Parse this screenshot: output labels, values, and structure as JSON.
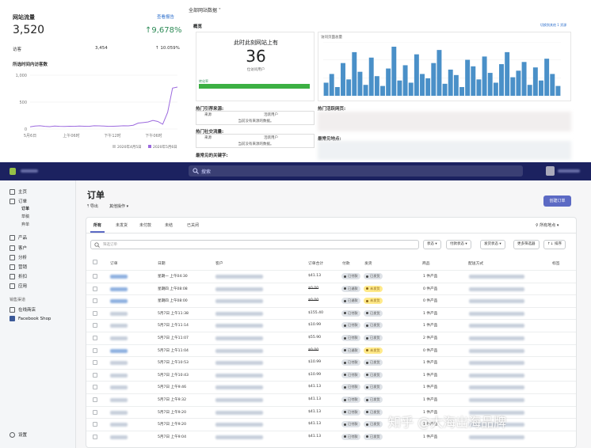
{
  "stats": {
    "title": "网站流量",
    "report_link": "查看报告",
    "total": "3,520",
    "change": "↑9,678%",
    "row_label": "访客",
    "row_value": "3,454",
    "row_change": "↑ 10.059%",
    "chart_title": "所选时间内访客数",
    "legend": [
      "2020年4月5日",
      "2020年5月6日"
    ],
    "colors": {
      "accent": "#2e8b57",
      "line": "#9c6ade",
      "link": "#2c6ecb"
    }
  },
  "chart_data": {
    "type": "line",
    "title": "所选时间内访客数",
    "yticks": [
      "1,000",
      "500",
      "0"
    ],
    "xticks": [
      "5月6日",
      "上午06时",
      "下午12时",
      "下午06时"
    ],
    "ylim": [
      0,
      1000
    ],
    "series": [
      {
        "name": "2020年5月6日",
        "values": [
          40,
          55,
          60,
          50,
          45,
          55,
          50,
          48,
          52,
          50,
          55,
          52,
          50,
          60,
          58,
          55,
          50,
          52,
          55,
          60,
          58,
          70,
          110,
          120,
          130,
          160,
          140,
          90,
          310,
          760,
          780
        ]
      }
    ],
    "grid": true,
    "legend": "bottom"
  },
  "analytics": {
    "header": "全部网站数据 ˅",
    "section": "概览",
    "live_title": "此时此刻网站上有",
    "live_count": "36",
    "live_caption": "位访问用户",
    "progress_label": "转化率",
    "progress_value": 100,
    "chart_label": "访问页面总量",
    "top_right": "切换到其他 1 资源",
    "lists": [
      {
        "title": "热门引荐来源:",
        "cols": [
          "来源",
          "活跃用户"
        ],
        "note": "当前没有来源的数据。"
      },
      {
        "title": "热门社交流量:",
        "cols": [
          "来源",
          "活跃用户"
        ],
        "note": "当前没有来源的数据。"
      },
      {
        "title": "最常见的关键字:"
      }
    ],
    "right_titles": [
      "热门活跃网页:",
      "最常见地点:"
    ],
    "bars": [
      12,
      20,
      8,
      30,
      15,
      40,
      22,
      10,
      35,
      18,
      9,
      25,
      45,
      14,
      28,
      12,
      38,
      20,
      16,
      30,
      42,
      11,
      24,
      19,
      8,
      33,
      27,
      15,
      36,
      21,
      12,
      29,
      40,
      17,
      23,
      31,
      10,
      26,
      14,
      34,
      20,
      9
    ]
  },
  "topbar": {
    "store": "商店名称",
    "search_placeholder": "搜索",
    "user": "用户名称"
  },
  "sidebar": {
    "items": [
      {
        "label": "主页",
        "icon": "home-icon"
      },
      {
        "label": "订单",
        "icon": "orders-icon"
      },
      {
        "label": "产品",
        "icon": "tag-icon"
      },
      {
        "label": "客户",
        "icon": "person-icon"
      },
      {
        "label": "分析",
        "icon": "bar-chart-icon"
      },
      {
        "label": "营销",
        "icon": "megaphone-icon"
      },
      {
        "label": "折扣",
        "icon": "discount-icon"
      },
      {
        "label": "应用",
        "icon": "apps-icon"
      }
    ],
    "subitems": [
      "订单",
      "草稿",
      "弃单"
    ],
    "channels_title": "销售渠道",
    "channels": [
      "在线商店",
      "Facebook Shop"
    ],
    "settings": "设置"
  },
  "orders": {
    "title": "订单",
    "export": "导出",
    "more": "其他操作 ▾",
    "create": "创建订单",
    "tabs": [
      "所有",
      "未发货",
      "未付款",
      "未结",
      "已关闭"
    ],
    "location": "所有地点 ▾",
    "search_placeholder": "筛选订单",
    "filters": [
      "状态 ▾",
      "付款状态 ▾",
      "发货状态 ▾",
      "更多筛选器",
      "↑↓ 排序"
    ],
    "columns": [
      "订单",
      "日期",
      "客户",
      "订单合计",
      "付款",
      "发货",
      "商品",
      "配送方式",
      "标签"
    ],
    "rows": [
      {
        "date": "星期一 上午04:30",
        "total": "$41.13",
        "pay": "已付款",
        "ship": "已发货",
        "items": "1 件产品",
        "struck": false
      },
      {
        "date": "星期四 上午08:08",
        "total": "$0.00",
        "pay": "已退款",
        "ship": "未发货",
        "items": "0 件产品",
        "struck": true
      },
      {
        "date": "星期四 上午08:00",
        "total": "$0.00",
        "pay": "已退款",
        "ship": "未发货",
        "items": "0 件产品",
        "struck": true
      },
      {
        "date": "5月7日 上午11:38",
        "total": "$155.40",
        "pay": "已付款",
        "ship": "已发货",
        "items": "1 件产品",
        "struck": false
      },
      {
        "date": "5月7日 上午11:14",
        "total": "$10.99",
        "pay": "已付款",
        "ship": "已发货",
        "items": "1 件产品",
        "struck": false
      },
      {
        "date": "5月7日 上午11:07",
        "total": "$55.90",
        "pay": "已付款",
        "ship": "已发货",
        "items": "2 件产品",
        "struck": false
      },
      {
        "date": "5月7日 上午11:04",
        "total": "$0.00",
        "pay": "已退款",
        "ship": "未发货",
        "items": "0 件产品",
        "struck": true
      },
      {
        "date": "5月7日 上午10:53",
        "total": "$10.99",
        "pay": "已付款",
        "ship": "已发货",
        "items": "1 件产品",
        "struck": false
      },
      {
        "date": "5月7日 上午10:43",
        "total": "$10.99",
        "pay": "已付款",
        "ship": "已发货",
        "items": "1 件产品",
        "struck": false
      },
      {
        "date": "5月7日 上午9:46",
        "total": "$41.13",
        "pay": "已付款",
        "ship": "已发货",
        "items": "1 件产品",
        "struck": false
      },
      {
        "date": "5月7日 上午9:32",
        "total": "$41.13",
        "pay": "已付款",
        "ship": "已发货",
        "items": "1 件产品",
        "struck": false
      },
      {
        "date": "5月7日 上午9:20",
        "total": "$41.13",
        "pay": "已付款",
        "ship": "已发货",
        "items": "1 件产品",
        "struck": false
      },
      {
        "date": "5月7日 上午9:20",
        "total": "$41.13",
        "pay": "已付款",
        "ship": "已发货",
        "items": "1 件产品",
        "struck": false
      },
      {
        "date": "5月7日 上午9:04",
        "total": "$41.13",
        "pay": "已付款",
        "ship": "已发货",
        "items": "1 件产品",
        "struck": false
      }
    ],
    "badge_colors": {
      "paid": "#dfe3e8",
      "refunded": "#dfe3e8",
      "shipped": "#dfe3e8",
      "unshipped": "#ffea8a"
    }
  },
  "watermark": "知乎 @大海出海品牌"
}
